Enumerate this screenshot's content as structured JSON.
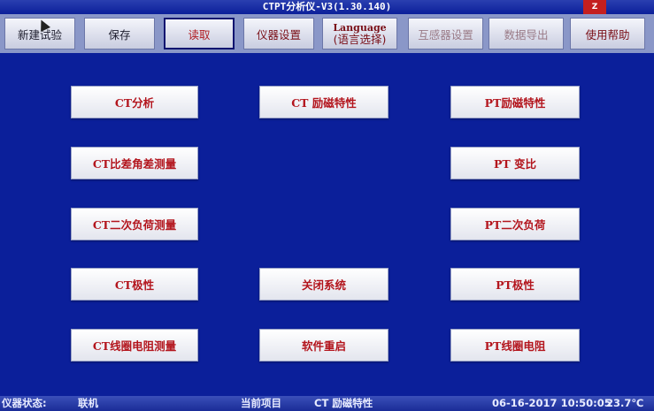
{
  "title": "CTPT分析仪-V3(1.30.140)",
  "indicator": "Z",
  "toolbar": {
    "new_test": "新建试验",
    "save": "保存",
    "read": "读取",
    "instrument_settings": "仪器设置",
    "language_en": "Language",
    "language_cn": "(语言选择)",
    "transformer_settings": "互感器设置",
    "data_export": "数据导出",
    "help": "使用帮助"
  },
  "menu": {
    "ct_analysis": "CT分析",
    "ct_excitation": "CT 励磁特性",
    "pt_excitation": "PT励磁特性",
    "ct_ratio_angle": "CT比差角差测量",
    "pt_ratio": "PT 变比",
    "ct_secondary_burden": "CT二次负荷测量",
    "pt_secondary_burden": "PT二次负荷",
    "ct_polarity": "CT极性",
    "shutdown": "关闭系统",
    "pt_polarity": "PT极性",
    "ct_coil_resistance": "CT线圈电阻测量",
    "restart": "软件重启",
    "pt_coil_resistance": "PT线圈电阻"
  },
  "status": {
    "instrument_status_label": "仪器状态:",
    "instrument_status_value": "联机",
    "current_item_label": "当前项目",
    "current_item_value": "CT 励磁特性",
    "datetime": "06-16-2017 10:50:05",
    "temperature": "23.7℃"
  }
}
